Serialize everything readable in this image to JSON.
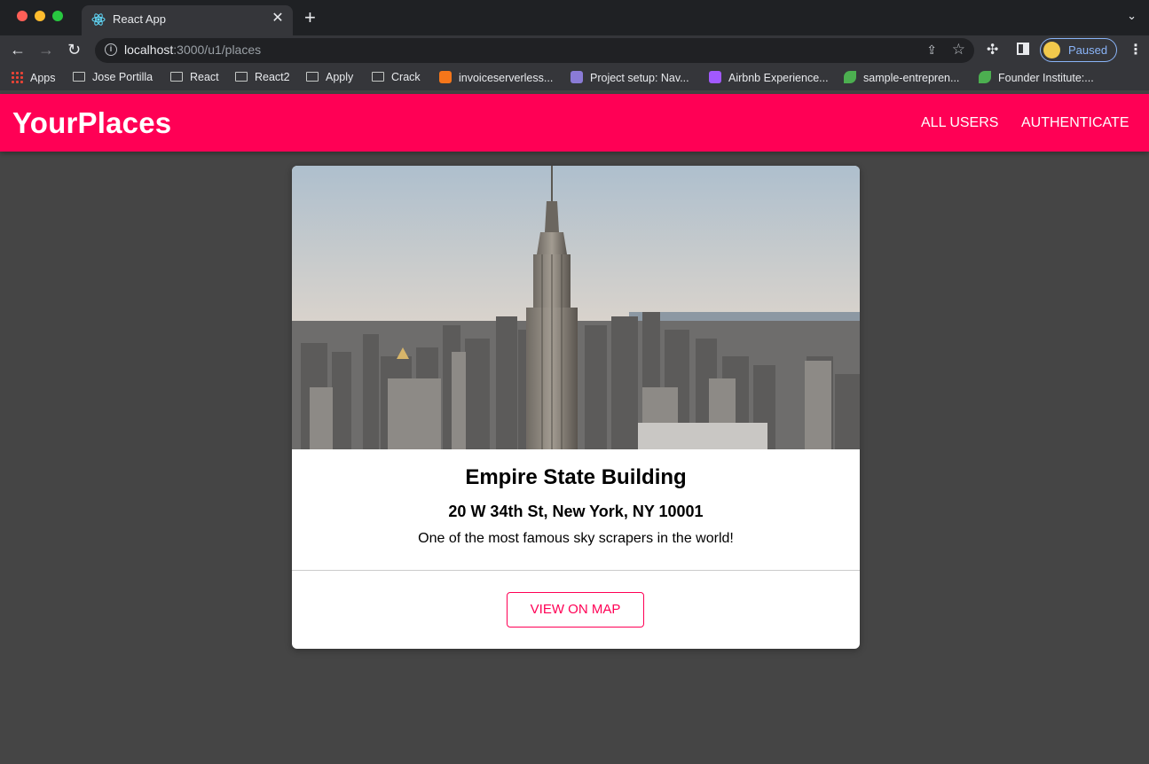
{
  "browser": {
    "tab_title": "React App",
    "url_host": "localhost",
    "url_path": ":3000/u1/places",
    "profile_label": "Paused",
    "bookmarks": [
      {
        "label": "Apps",
        "icon": "apps-grid-icon"
      },
      {
        "label": "Jose Portilla",
        "icon": "folder-icon"
      },
      {
        "label": "React",
        "icon": "folder-icon"
      },
      {
        "label": "React2",
        "icon": "folder-icon"
      },
      {
        "label": "Apply",
        "icon": "folder-icon"
      },
      {
        "label": "Crack",
        "icon": "folder-icon"
      },
      {
        "label": "invoiceserverless...",
        "icon": "aws-icon",
        "color": "#f5761a"
      },
      {
        "label": "Project setup: Nav...",
        "icon": "project-icon",
        "color": "#8a7bd6"
      },
      {
        "label": "Airbnb Experience...",
        "icon": "figma-icon",
        "color": "#a259ff"
      },
      {
        "label": "sample-entrepren...",
        "icon": "leaf-icon",
        "color": "#4caf50"
      },
      {
        "label": "Founder Institute:...",
        "icon": "leaf-icon",
        "color": "#4caf50"
      }
    ]
  },
  "app": {
    "brand": "YourPlaces",
    "nav": {
      "all_users": "ALL USERS",
      "authenticate": "AUTHENTICATE"
    },
    "accent_color": "#ff0055"
  },
  "place": {
    "image_alt": "Empire State Building",
    "title": "Empire State Building",
    "address": "20 W 34th St, New York, NY 10001",
    "description": "One of the most famous sky scrapers in the world!",
    "view_button": "VIEW ON MAP"
  }
}
